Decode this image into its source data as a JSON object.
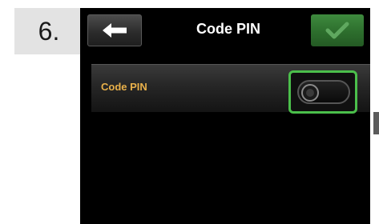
{
  "step": {
    "number": "6."
  },
  "header": {
    "title": "Code PIN",
    "back_icon": "arrow-left-icon",
    "confirm_icon": "checkmark-icon"
  },
  "settings": [
    {
      "label": "Code PIN",
      "toggle_state": "off"
    }
  ],
  "colors": {
    "accent_green": "#4bbf4b",
    "label_orange": "#e8b04a",
    "confirm_green": "#2d6e2d"
  }
}
